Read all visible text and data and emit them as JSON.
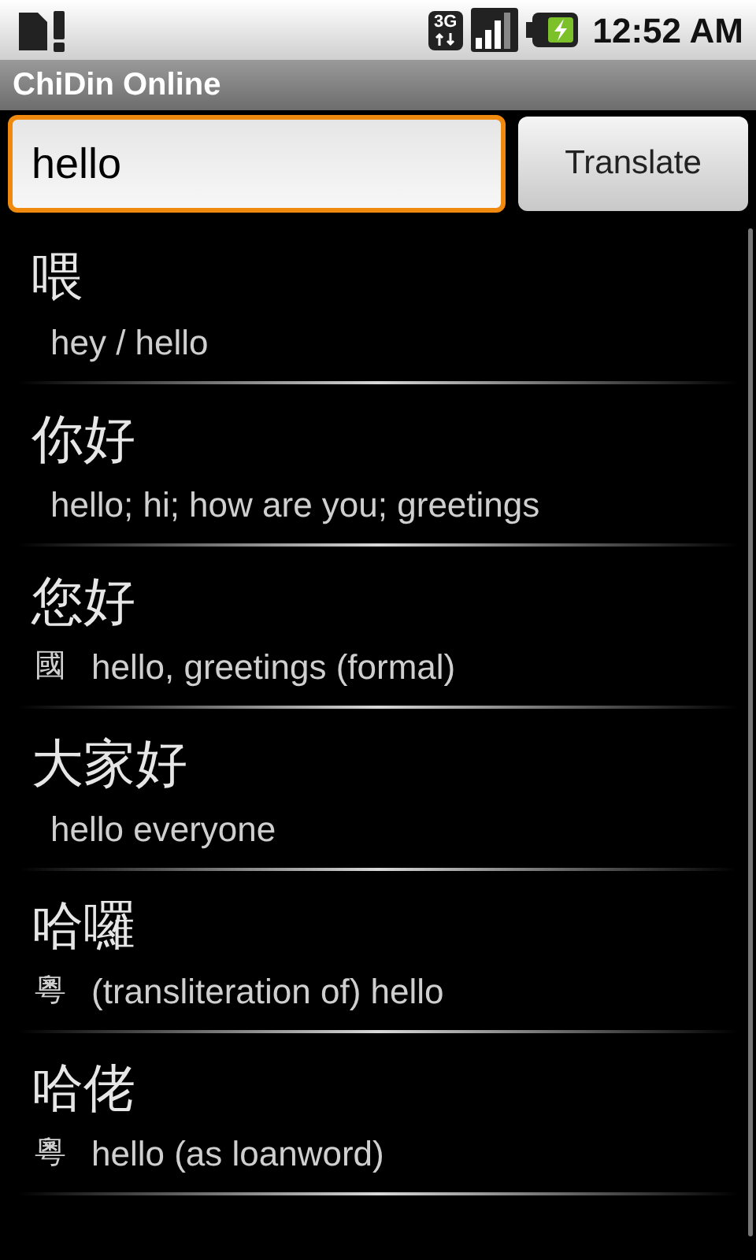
{
  "status_bar": {
    "network": "3G",
    "time": "12:52 AM"
  },
  "app_title": "ChiDin Online",
  "search": {
    "value": "hello",
    "focused": true
  },
  "translate_button": "Translate",
  "results": [
    {
      "headword": "喂",
      "gloss": "hey / hello"
    },
    {
      "headword": "你好",
      "gloss": "hello; hi; how are you; greetings"
    },
    {
      "headword": "您好",
      "tag": "國",
      "gloss": "hello, greetings (formal)"
    },
    {
      "headword": "大家好",
      "gloss": "hello everyone"
    },
    {
      "headword": "哈囉",
      "tag": "粵",
      "gloss": "(transliteration of) hello"
    },
    {
      "headword": "哈佬",
      "tag": "粵",
      "gloss": "hello (as loanword)"
    }
  ]
}
